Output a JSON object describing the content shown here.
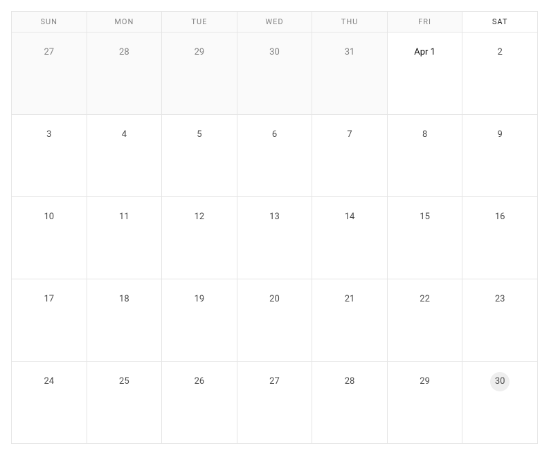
{
  "calendar": {
    "headers": [
      {
        "label": "SUN",
        "inMonth": false
      },
      {
        "label": "MON",
        "inMonth": false
      },
      {
        "label": "TUE",
        "inMonth": false
      },
      {
        "label": "WED",
        "inMonth": false
      },
      {
        "label": "THU",
        "inMonth": false
      },
      {
        "label": "FRI",
        "inMonth": false
      },
      {
        "label": "SAT",
        "inMonth": true
      }
    ],
    "weeks": [
      [
        {
          "label": "27",
          "otherMonth": true,
          "today": false,
          "monthStart": false
        },
        {
          "label": "28",
          "otherMonth": true,
          "today": false,
          "monthStart": false
        },
        {
          "label": "29",
          "otherMonth": true,
          "today": false,
          "monthStart": false
        },
        {
          "label": "30",
          "otherMonth": true,
          "today": false,
          "monthStart": false
        },
        {
          "label": "31",
          "otherMonth": true,
          "today": false,
          "monthStart": false
        },
        {
          "label": "Apr 1",
          "otherMonth": false,
          "today": false,
          "monthStart": true
        },
        {
          "label": "2",
          "otherMonth": false,
          "today": false,
          "monthStart": false
        }
      ],
      [
        {
          "label": "3",
          "otherMonth": false,
          "today": false,
          "monthStart": false
        },
        {
          "label": "4",
          "otherMonth": false,
          "today": false,
          "monthStart": false
        },
        {
          "label": "5",
          "otherMonth": false,
          "today": false,
          "monthStart": false
        },
        {
          "label": "6",
          "otherMonth": false,
          "today": false,
          "monthStart": false
        },
        {
          "label": "7",
          "otherMonth": false,
          "today": false,
          "monthStart": false
        },
        {
          "label": "8",
          "otherMonth": false,
          "today": false,
          "monthStart": false
        },
        {
          "label": "9",
          "otherMonth": false,
          "today": false,
          "monthStart": false
        }
      ],
      [
        {
          "label": "10",
          "otherMonth": false,
          "today": false,
          "monthStart": false
        },
        {
          "label": "11",
          "otherMonth": false,
          "today": false,
          "monthStart": false
        },
        {
          "label": "12",
          "otherMonth": false,
          "today": false,
          "monthStart": false
        },
        {
          "label": "13",
          "otherMonth": false,
          "today": false,
          "monthStart": false
        },
        {
          "label": "14",
          "otherMonth": false,
          "today": false,
          "monthStart": false
        },
        {
          "label": "15",
          "otherMonth": false,
          "today": false,
          "monthStart": false
        },
        {
          "label": "16",
          "otherMonth": false,
          "today": false,
          "monthStart": false
        }
      ],
      [
        {
          "label": "17",
          "otherMonth": false,
          "today": false,
          "monthStart": false
        },
        {
          "label": "18",
          "otherMonth": false,
          "today": false,
          "monthStart": false
        },
        {
          "label": "19",
          "otherMonth": false,
          "today": false,
          "monthStart": false
        },
        {
          "label": "20",
          "otherMonth": false,
          "today": false,
          "monthStart": false
        },
        {
          "label": "21",
          "otherMonth": false,
          "today": false,
          "monthStart": false
        },
        {
          "label": "22",
          "otherMonth": false,
          "today": false,
          "monthStart": false
        },
        {
          "label": "23",
          "otherMonth": false,
          "today": false,
          "monthStart": false
        }
      ],
      [
        {
          "label": "24",
          "otherMonth": false,
          "today": false,
          "monthStart": false
        },
        {
          "label": "25",
          "otherMonth": false,
          "today": false,
          "monthStart": false
        },
        {
          "label": "26",
          "otherMonth": false,
          "today": false,
          "monthStart": false
        },
        {
          "label": "27",
          "otherMonth": false,
          "today": false,
          "monthStart": false
        },
        {
          "label": "28",
          "otherMonth": false,
          "today": false,
          "monthStart": false
        },
        {
          "label": "29",
          "otherMonth": false,
          "today": false,
          "monthStart": false
        },
        {
          "label": "30",
          "otherMonth": false,
          "today": true,
          "monthStart": false
        }
      ]
    ]
  }
}
